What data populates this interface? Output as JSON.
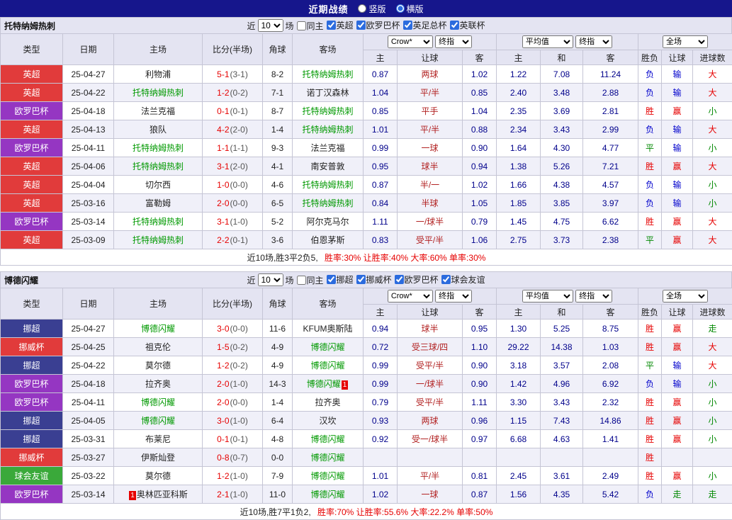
{
  "title_bar": {
    "title": "近期战绩",
    "options": [
      {
        "label": "竖版",
        "selected": false
      },
      {
        "label": "横版",
        "selected": true
      }
    ]
  },
  "filter_labels": {
    "near": "近",
    "games": "场",
    "same_home": "同主"
  },
  "table_header": {
    "type": "类型",
    "date": "日期",
    "home": "主场",
    "score": "比分(半场)",
    "corner": "角球",
    "away": "客场",
    "odds_source": "Crow*",
    "final_label": "终指",
    "avg_label": "平均值",
    "final_label2": "终指",
    "fulltime_label": "全场",
    "sub": [
      "主",
      "让球",
      "客",
      "主",
      "和",
      "客",
      "胜负",
      "让球",
      "进球数"
    ]
  },
  "colors": {
    "topbar_bg": "#16168c",
    "header_bg": "#e4e4f2",
    "alt_row_bg": "#f0f0f9",
    "focus_team": "#009900",
    "score": "#e60000",
    "odds": "#00008b",
    "handicap": "#b22222"
  },
  "league_colors": {
    "英超": "#e13b3b",
    "欧罗巴杯": "#9536c2",
    "挪超": "#3a3f92",
    "挪威杯": "#e13b3b",
    "球会友谊": "#3aa93a"
  },
  "result_colors": {
    "胜": "#e60000",
    "赢": "#e60000",
    "大": "#e60000",
    "平": "#008800",
    "走": "#008800",
    "小": "#008800",
    "负": "#0000cc",
    "输": "#0000cc"
  },
  "sections": [
    {
      "team": "托特纳姆热刺",
      "filter": {
        "count": "10",
        "leagues": [
          "英超",
          "欧罗巴杯",
          "英足总杯",
          "英联杯"
        ]
      },
      "rows": [
        {
          "league": "英超",
          "date": "25-04-27",
          "home": {
            "name": "利物浦",
            "focus": false
          },
          "score": "5-1",
          "half": "(3-1)",
          "corner": "8-2",
          "away": {
            "name": "托特纳姆热刺",
            "focus": true
          },
          "odds": [
            "0.87",
            "两球",
            "1.02"
          ],
          "avg": [
            "1.22",
            "7.08",
            "11.24"
          ],
          "results": [
            "负",
            "输",
            "大"
          ]
        },
        {
          "league": "英超",
          "date": "25-04-22",
          "home": {
            "name": "托特纳姆热刺",
            "focus": true
          },
          "score": "1-2",
          "half": "(0-2)",
          "corner": "7-1",
          "away": {
            "name": "诺丁汉森林",
            "focus": false
          },
          "odds": [
            "1.04",
            "平/半",
            "0.85"
          ],
          "avg": [
            "2.40",
            "3.48",
            "2.88"
          ],
          "results": [
            "负",
            "输",
            "大"
          ]
        },
        {
          "league": "欧罗巴杯",
          "date": "25-04-18",
          "home": {
            "name": "法兰克福",
            "focus": false
          },
          "score": "0-1",
          "half": "(0-1)",
          "corner": "8-7",
          "away": {
            "name": "托特纳姆热刺",
            "focus": true
          },
          "odds": [
            "0.85",
            "平手",
            "1.04"
          ],
          "avg": [
            "2.35",
            "3.69",
            "2.81"
          ],
          "results": [
            "胜",
            "赢",
            "小"
          ]
        },
        {
          "league": "英超",
          "date": "25-04-13",
          "home": {
            "name": "狼队",
            "focus": false
          },
          "score": "4-2",
          "half": "(2-0)",
          "corner": "1-4",
          "away": {
            "name": "托特纳姆热刺",
            "focus": true
          },
          "odds": [
            "1.01",
            "平/半",
            "0.88"
          ],
          "avg": [
            "2.34",
            "3.43",
            "2.99"
          ],
          "results": [
            "负",
            "输",
            "大"
          ]
        },
        {
          "league": "欧罗巴杯",
          "date": "25-04-11",
          "home": {
            "name": "托特纳姆热刺",
            "focus": true
          },
          "score": "1-1",
          "half": "(1-1)",
          "corner": "9-3",
          "away": {
            "name": "法兰克福",
            "focus": false
          },
          "odds": [
            "0.99",
            "一球",
            "0.90"
          ],
          "avg": [
            "1.64",
            "4.30",
            "4.77"
          ],
          "results": [
            "平",
            "输",
            "小"
          ]
        },
        {
          "league": "英超",
          "date": "25-04-06",
          "home": {
            "name": "托特纳姆热刺",
            "focus": true
          },
          "score": "3-1",
          "half": "(2-0)",
          "corner": "4-1",
          "away": {
            "name": "南安普敦",
            "focus": false
          },
          "odds": [
            "0.95",
            "球半",
            "0.94"
          ],
          "avg": [
            "1.38",
            "5.26",
            "7.21"
          ],
          "results": [
            "胜",
            "赢",
            "大"
          ]
        },
        {
          "league": "英超",
          "date": "25-04-04",
          "home": {
            "name": "切尔西",
            "focus": false
          },
          "score": "1-0",
          "half": "(0-0)",
          "corner": "4-6",
          "away": {
            "name": "托特纳姆热刺",
            "focus": true
          },
          "odds": [
            "0.87",
            "半/一",
            "1.02"
          ],
          "avg": [
            "1.66",
            "4.38",
            "4.57"
          ],
          "results": [
            "负",
            "输",
            "小"
          ]
        },
        {
          "league": "英超",
          "date": "25-03-16",
          "home": {
            "name": "富勒姆",
            "focus": false
          },
          "score": "2-0",
          "half": "(0-0)",
          "corner": "6-5",
          "away": {
            "name": "托特纳姆热刺",
            "focus": true
          },
          "odds": [
            "0.84",
            "半球",
            "1.05"
          ],
          "avg": [
            "1.85",
            "3.85",
            "3.97"
          ],
          "results": [
            "负",
            "输",
            "小"
          ]
        },
        {
          "league": "欧罗巴杯",
          "date": "25-03-14",
          "home": {
            "name": "托特纳姆热刺",
            "focus": true
          },
          "score": "3-1",
          "half": "(1-0)",
          "corner": "5-2",
          "away": {
            "name": "阿尔克马尔",
            "focus": false
          },
          "odds": [
            "1.11",
            "一/球半",
            "0.79"
          ],
          "avg": [
            "1.45",
            "4.75",
            "6.62"
          ],
          "results": [
            "胜",
            "赢",
            "大"
          ]
        },
        {
          "league": "英超",
          "date": "25-03-09",
          "home": {
            "name": "托特纳姆热刺",
            "focus": true
          },
          "score": "2-2",
          "half": "(0-1)",
          "corner": "3-6",
          "away": {
            "name": "伯恩茅斯",
            "focus": false
          },
          "odds": [
            "0.83",
            "受平/半",
            "1.06"
          ],
          "avg": [
            "2.75",
            "3.73",
            "2.38"
          ],
          "results": [
            "平",
            "赢",
            "大"
          ]
        }
      ],
      "footer": {
        "summary": "近10场,胜3平2负5,",
        "stats": "胜率:30% 让胜率:40% 大率:60% 单率:30%"
      }
    },
    {
      "team": "博德闪耀",
      "filter": {
        "count": "10",
        "leagues": [
          "挪超",
          "挪威杯",
          "欧罗巴杯",
          "球会友谊"
        ]
      },
      "rows": [
        {
          "league": "挪超",
          "date": "25-04-27",
          "home": {
            "name": "博德闪耀",
            "focus": true
          },
          "score": "3-0",
          "half": "(0-0)",
          "corner": "11-6",
          "away": {
            "name": "KFUM奥斯陆",
            "focus": false
          },
          "odds": [
            "0.94",
            "球半",
            "0.95"
          ],
          "avg": [
            "1.30",
            "5.25",
            "8.75"
          ],
          "results": [
            "胜",
            "赢",
            "走"
          ]
        },
        {
          "league": "挪威杯",
          "date": "25-04-25",
          "home": {
            "name": "祖克伦",
            "focus": false
          },
          "score": "1-5",
          "half": "(0-2)",
          "corner": "4-9",
          "away": {
            "name": "博德闪耀",
            "focus": true
          },
          "odds": [
            "0.72",
            "受三球/四",
            "1.10"
          ],
          "avg": [
            "29.22",
            "14.38",
            "1.03"
          ],
          "results": [
            "胜",
            "赢",
            "大"
          ]
        },
        {
          "league": "挪超",
          "date": "25-04-22",
          "home": {
            "name": "莫尔德",
            "focus": false
          },
          "score": "1-2",
          "half": "(0-2)",
          "corner": "4-9",
          "away": {
            "name": "博德闪耀",
            "focus": true
          },
          "odds": [
            "0.99",
            "受平/半",
            "0.90"
          ],
          "avg": [
            "3.18",
            "3.57",
            "2.08"
          ],
          "results": [
            "平",
            "输",
            "大"
          ]
        },
        {
          "league": "欧罗巴杯",
          "date": "25-04-18",
          "home": {
            "name": "拉齐奥",
            "focus": false
          },
          "score": "2-0",
          "half": "(1-0)",
          "corner": "14-3",
          "away": {
            "name": "博德闪耀",
            "focus": true,
            "badge": "1",
            "badge_pos": "after"
          },
          "odds": [
            "0.99",
            "一/球半",
            "0.90"
          ],
          "avg": [
            "1.42",
            "4.96",
            "6.92"
          ],
          "results": [
            "负",
            "输",
            "小"
          ]
        },
        {
          "league": "欧罗巴杯",
          "date": "25-04-11",
          "home": {
            "name": "博德闪耀",
            "focus": true
          },
          "score": "2-0",
          "half": "(0-0)",
          "corner": "1-4",
          "away": {
            "name": "拉齐奥",
            "focus": false
          },
          "odds": [
            "0.79",
            "受平/半",
            "1.11"
          ],
          "avg": [
            "3.30",
            "3.43",
            "2.32"
          ],
          "results": [
            "胜",
            "赢",
            "小"
          ]
        },
        {
          "league": "挪超",
          "date": "25-04-05",
          "home": {
            "name": "博德闪耀",
            "focus": true
          },
          "score": "3-0",
          "half": "(1-0)",
          "corner": "6-4",
          "away": {
            "name": "汉坎",
            "focus": false
          },
          "odds": [
            "0.93",
            "两球",
            "0.96"
          ],
          "avg": [
            "1.15",
            "7.43",
            "14.86"
          ],
          "results": [
            "胜",
            "赢",
            "小"
          ]
        },
        {
          "league": "挪超",
          "date": "25-03-31",
          "home": {
            "name": "布莱尼",
            "focus": false
          },
          "score": "0-1",
          "half": "(0-1)",
          "corner": "4-8",
          "away": {
            "name": "博德闪耀",
            "focus": true
          },
          "odds": [
            "0.92",
            "受一/球半",
            "0.97"
          ],
          "avg": [
            "6.68",
            "4.63",
            "1.41"
          ],
          "results": [
            "胜",
            "赢",
            "小"
          ]
        },
        {
          "league": "挪威杯",
          "date": "25-03-27",
          "home": {
            "name": "伊斯灿登",
            "focus": false
          },
          "score": "0-8",
          "half": "(0-7)",
          "corner": "0-0",
          "away": {
            "name": "博德闪耀",
            "focus": true
          },
          "odds": [
            "",
            "",
            ""
          ],
          "avg": [
            "",
            "",
            ""
          ],
          "results": [
            "胜",
            "",
            ""
          ]
        },
        {
          "league": "球会友谊",
          "date": "25-03-22",
          "home": {
            "name": "莫尔德",
            "focus": false
          },
          "score": "1-2",
          "half": "(1-0)",
          "corner": "7-9",
          "away": {
            "name": "博德闪耀",
            "focus": true
          },
          "odds": [
            "1.01",
            "平/半",
            "0.81"
          ],
          "avg": [
            "2.45",
            "3.61",
            "2.49"
          ],
          "results": [
            "胜",
            "赢",
            "小"
          ]
        },
        {
          "league": "欧罗巴杯",
          "date": "25-03-14",
          "home": {
            "name": "奥林匹亚科斯",
            "focus": false,
            "badge": "1",
            "badge_pos": "before"
          },
          "score": "2-1",
          "half": "(1-0)",
          "corner": "11-0",
          "away": {
            "name": "博德闪耀",
            "focus": true
          },
          "odds": [
            "1.02",
            "一球",
            "0.87"
          ],
          "avg": [
            "1.56",
            "4.35",
            "5.42"
          ],
          "results": [
            "负",
            "走",
            "走"
          ]
        }
      ],
      "footer": {
        "summary": "近10场,胜7平1负2,",
        "stats": "胜率:70% 让胜率:55.6% 大率:22.2% 单率:50%"
      }
    }
  ]
}
